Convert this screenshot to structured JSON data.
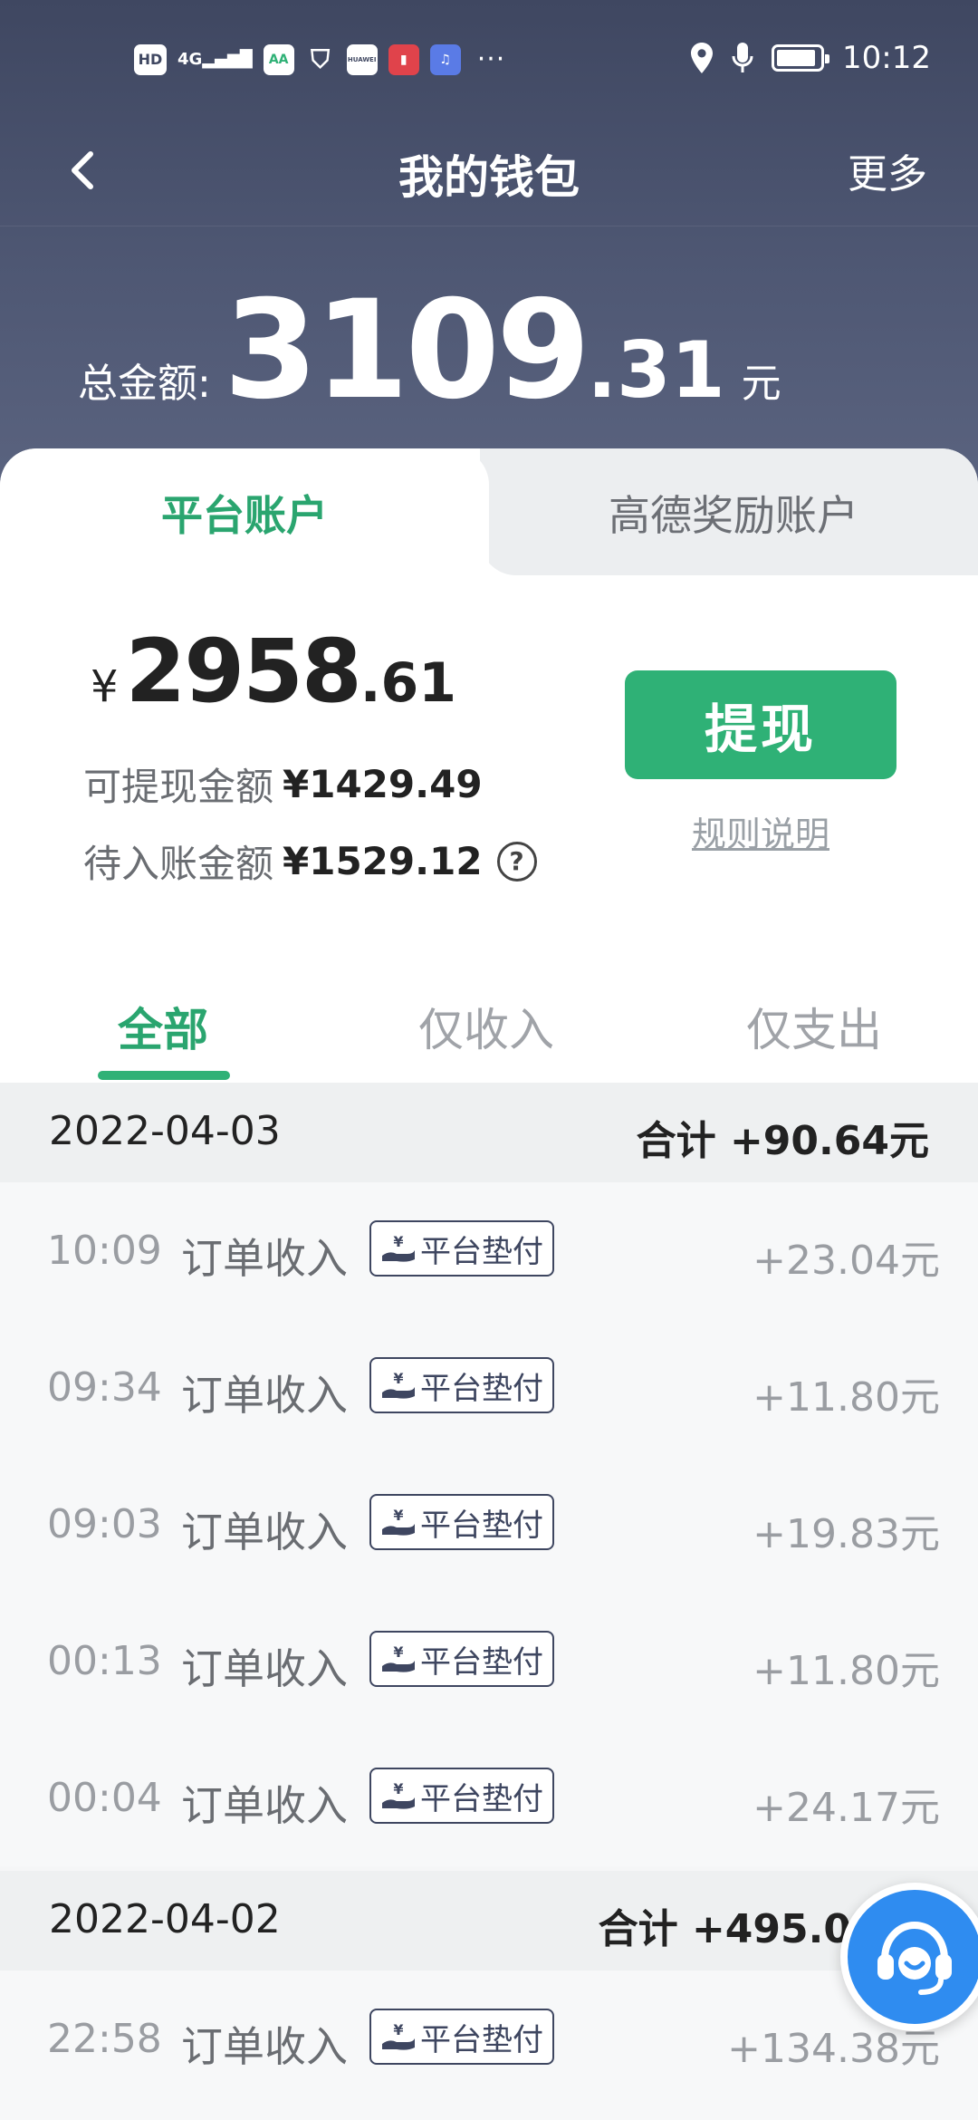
{
  "status_bar": {
    "left_icons": [
      "HD",
      "4G signal",
      "app-icon-aa",
      "shield-app-icon",
      "huawei-store-icon",
      "book-app-icon",
      "music-app-icon"
    ],
    "hd_label": "HD",
    "network_label": "4G",
    "aa_label": "AA",
    "huawei_label": "HUAWEI",
    "overflow": "···",
    "time": "10:12"
  },
  "nav": {
    "title": "我的钱包",
    "more": "更多"
  },
  "total": {
    "label": "总金额:",
    "integer": "3109",
    "decimal": ".31",
    "unit": "元"
  },
  "account_tabs": {
    "platform": "平台账户",
    "gaode": "高德奖励账户"
  },
  "balance": {
    "currency": "¥",
    "integer": "2958",
    "decimal": ".61",
    "withdrawable_label": "可提现金额",
    "withdrawable_amount": "¥1429.49",
    "pending_label": "待入账金额",
    "pending_amount": "¥1529.12",
    "help": "?",
    "withdraw_button": "提现",
    "rules_link": "规则说明"
  },
  "filter_tabs": {
    "all": "全部",
    "income": "仅收入",
    "expense": "仅支出"
  },
  "groups": [
    {
      "date": "2022-04-03",
      "summary": "合计 +90.64元",
      "rows": [
        {
          "time": "10:09",
          "type": "订单收入",
          "tag": "平台垫付",
          "amount": "+23.04元"
        },
        {
          "time": "09:34",
          "type": "订单收入",
          "tag": "平台垫付",
          "amount": "+11.80元"
        },
        {
          "time": "09:03",
          "type": "订单收入",
          "tag": "平台垫付",
          "amount": "+19.83元"
        },
        {
          "time": "00:13",
          "type": "订单收入",
          "tag": "平台垫付",
          "amount": "+11.80元"
        },
        {
          "time": "00:04",
          "type": "订单收入",
          "tag": "平台垫付",
          "amount": "+24.17元"
        }
      ]
    },
    {
      "date": "2022-04-02",
      "summary": "合计 +495.0",
      "rows": [
        {
          "time": "22:58",
          "type": "订单收入",
          "tag": "平台垫付",
          "amount": "+134.38元"
        }
      ]
    }
  ],
  "colors": {
    "accent_green": "#2fb176",
    "header_dark": "#3f4761",
    "support_blue": "#2f8cf0"
  }
}
